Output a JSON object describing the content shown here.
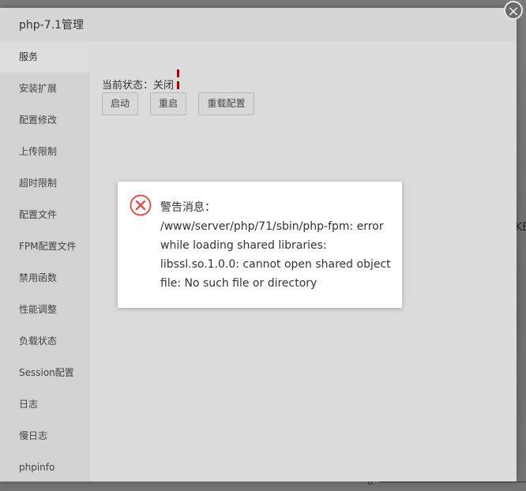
{
  "background": {
    "right_fragment": "KB",
    "axis_zero": "0"
  },
  "dialog": {
    "title": "php-7.1管理",
    "close_symbol": "×"
  },
  "sidebar": {
    "items": [
      {
        "label": "服务",
        "active": true
      },
      {
        "label": "安装扩展",
        "active": false
      },
      {
        "label": "配置修改",
        "active": false
      },
      {
        "label": "上传限制",
        "active": false
      },
      {
        "label": "超时限制",
        "active": false
      },
      {
        "label": "配置文件",
        "active": false
      },
      {
        "label": "FPM配置文件",
        "active": false
      },
      {
        "label": "禁用函数",
        "active": false
      },
      {
        "label": "性能调整",
        "active": false
      },
      {
        "label": "负载状态",
        "active": false
      },
      {
        "label": "Session配置",
        "active": false
      },
      {
        "label": "日志",
        "active": false
      },
      {
        "label": "慢日志",
        "active": false
      },
      {
        "label": "phpinfo",
        "active": false
      }
    ]
  },
  "service": {
    "status_label": "当前状态：",
    "status_value": "关闭",
    "status_color": "#b00000",
    "buttons": {
      "start": "启动",
      "restart": "重启",
      "reload": "重载配置"
    }
  },
  "alert": {
    "icon": "error-circle-icon",
    "icon_color": "#e0504b",
    "title": "警告消息：",
    "message": "/www/server/php/71/sbin/php-fpm: error while loading shared libraries: libssl.so.1.0.0: cannot open shared object file: No such file or directory"
  }
}
